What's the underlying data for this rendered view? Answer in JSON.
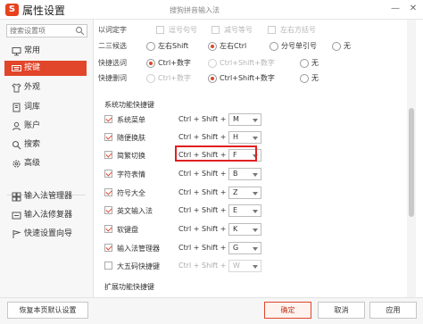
{
  "window": {
    "title": "属性设置",
    "logo_text": "S",
    "center_title": "搜狗拼音输入法",
    "minimize_label": "—",
    "close_label": "✕"
  },
  "sidebar": {
    "search_placeholder": "搜索设置项",
    "items": [
      {
        "label": "常用",
        "icon": "monitor-icon"
      },
      {
        "label": "按键",
        "icon": "keyboard-icon",
        "active": true
      },
      {
        "label": "外观",
        "icon": "shirt-icon"
      },
      {
        "label": "词库",
        "icon": "book-icon"
      },
      {
        "label": "账户",
        "icon": "user-icon"
      },
      {
        "label": "搜索",
        "icon": "search-icon"
      },
      {
        "label": "高级",
        "icon": "gear-icon"
      }
    ],
    "tools": [
      {
        "label": "输入法管理器",
        "icon": "manager-icon"
      },
      {
        "label": "输入法修复器",
        "icon": "repair-icon"
      },
      {
        "label": "快速设置向导",
        "icon": "wizard-icon"
      }
    ]
  },
  "settings": {
    "row_fixed_word": {
      "label": "以词定字",
      "opt1": "逗号句号",
      "opt2": "减号等号",
      "opt3": "左右方括号"
    },
    "row_candidate": {
      "label": "二三候选",
      "opt1": "左右Shift",
      "opt2": "左右Ctrl",
      "opt3": "分号单引号",
      "opt4": "无"
    },
    "row_quick_select": {
      "label": "快捷选词",
      "opt1": "Ctrl+数字",
      "opt2": "Ctrl+Shift+数字",
      "opt3": "无"
    },
    "row_quick_delete": {
      "label": "快捷删词",
      "opt1": "Ctrl+数字",
      "opt2": "Ctrl+Shift+数字",
      "opt3": "无"
    }
  },
  "shortcuts": {
    "section_title": "系统功能快捷键",
    "prefix": "Ctrl + Shift +",
    "items": [
      {
        "label": "系统菜单",
        "key": "M",
        "checked": true
      },
      {
        "label": "随便换肤",
        "key": "H",
        "checked": true
      },
      {
        "label": "简繁切换",
        "key": "F",
        "checked": true
      },
      {
        "label": "字符表情",
        "key": "B",
        "checked": true
      },
      {
        "label": "符号大全",
        "key": "Z",
        "checked": true
      },
      {
        "label": "英文输入法",
        "key": "E",
        "checked": true
      },
      {
        "label": "软键盘",
        "key": "K",
        "checked": true
      },
      {
        "label": "输入法管理器",
        "key": "G",
        "checked": true
      },
      {
        "label": "大五码快捷键",
        "key": "W",
        "checked": false
      }
    ],
    "ext_section_title": "扩展功能快捷键"
  },
  "footer": {
    "reset_label": "恢复本页默认设置",
    "ok_label": "确定",
    "cancel_label": "取消",
    "apply_label": "应用"
  },
  "colors": {
    "accent": "#e1452a",
    "highlight_box": "#e02020"
  }
}
